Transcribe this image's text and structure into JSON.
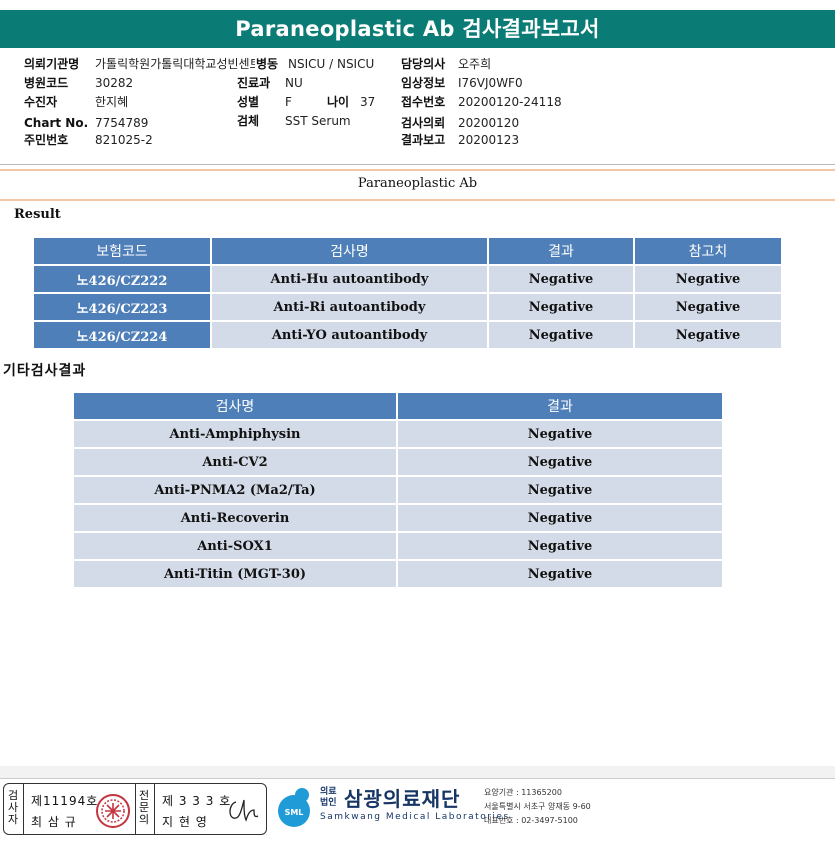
{
  "report": {
    "title": "Paraneoplastic Ab 검사결과보고서",
    "subtitle": "Paraneoplastic Ab",
    "result_heading": "Result",
    "other_heading": "기타검사결과"
  },
  "patient_info": {
    "col1": [
      {
        "label": "의뢰기관명",
        "value": "가톨릭학원가톨릭대학교성빈센트병원"
      },
      {
        "label": "병원코드",
        "value": "30282"
      },
      {
        "label": "수진자",
        "value": "한지혜"
      },
      {
        "label": "Chart No.",
        "value": "7754789"
      },
      {
        "label": "주민번호",
        "value": "821025-2"
      }
    ],
    "ward_label": "병동",
    "ward_value": "NSICU / NSICU",
    "dept_label": "진료과",
    "dept_value": "NU",
    "sex_label": "성별",
    "sex_value": "F",
    "age_label": "나이",
    "age_value": "37",
    "specimen_label": "검체",
    "specimen_value": "SST Serum",
    "col3": [
      {
        "label": "담당의사",
        "value": "오주희"
      },
      {
        "label": "임상정보",
        "value": "I76VJ0WF0"
      },
      {
        "label": "접수번호",
        "value": "20200120-24118"
      },
      {
        "label": "검사의뢰",
        "value": "20200120"
      },
      {
        "label": "결과보고",
        "value": "20200123"
      }
    ]
  },
  "result_table": {
    "headers": [
      "보험코드",
      "검사명",
      "결과",
      "참고치"
    ],
    "rows": [
      {
        "code": "노426/CZ222",
        "name": "Anti-Hu autoantibody",
        "result": "Negative",
        "ref": "Negative"
      },
      {
        "code": "노426/CZ223",
        "name": "Anti-Ri autoantibody",
        "result": "Negative",
        "ref": "Negative"
      },
      {
        "code": "노426/CZ224",
        "name": "Anti-YO autoantibody",
        "result": "Negative",
        "ref": "Negative"
      }
    ]
  },
  "other_table": {
    "headers": [
      "검사명",
      "결과"
    ],
    "rows": [
      {
        "name": "Anti-Amphiphysin",
        "result": "Negative"
      },
      {
        "name": "Anti-CV2",
        "result": "Negative"
      },
      {
        "name": "Anti-PNMA2 (Ma2/Ta)",
        "result": "Negative"
      },
      {
        "name": "Anti-Recoverin",
        "result": "Negative"
      },
      {
        "name": "Anti-SOX1",
        "result": "Negative"
      },
      {
        "name": "Anti-Titin (MGT-30)",
        "result": "Negative"
      }
    ]
  },
  "footer": {
    "tester_label": "검사자",
    "tester_no": "제11194호",
    "tester_name": "최 삼 규",
    "specialist_label": "전문의",
    "specialist_no": "제 3 3 3 호",
    "specialist_name": "지 현 영",
    "org_type": "의료\n법인",
    "org_name": "삼광의료재단",
    "org_en": "Samkwang Medical Laboratories",
    "logo_text": "SML",
    "contact": [
      "요양기관 : 11365200",
      "서울특별시 서초구 양재동 9-60",
      "대표번호 : 02-3497-5100"
    ]
  },
  "colors": {
    "title_bar": "#0b7b76",
    "header_cell": "#4f7fb8",
    "data_cell": "#d4dbe8",
    "accent_line": "#f3c7a6"
  }
}
